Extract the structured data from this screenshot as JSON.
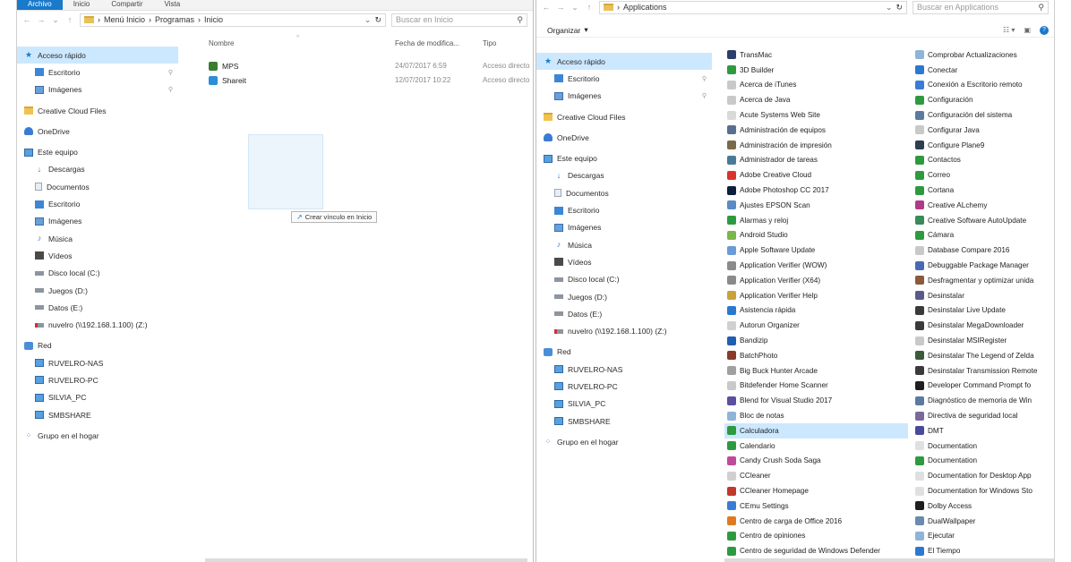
{
  "left": {
    "ribbon_tabs": [
      "Archivo",
      "Inicio",
      "Compartir",
      "Vista"
    ],
    "path": [
      "Menú Inicio",
      "Programas",
      "Inicio"
    ],
    "search_placeholder": "Buscar en Inicio",
    "nav": [
      {
        "label": "Acceso rápido",
        "icon": "star-icon",
        "sel": true
      },
      {
        "label": "Escritorio",
        "icon": "desktop-icon",
        "child": true,
        "pin": true
      },
      {
        "label": "Imágenes",
        "icon": "pictures-icon",
        "child": true,
        "pin": true
      },
      {
        "label": "Creative Cloud Files",
        "icon": "folder-icon"
      },
      {
        "label": "OneDrive",
        "icon": "cloud-icon"
      },
      {
        "label": "Este equipo",
        "icon": "computer-icon"
      },
      {
        "label": "Descargas",
        "icon": "download-icon",
        "child": true
      },
      {
        "label": "Documentos",
        "icon": "documents-icon",
        "child": true
      },
      {
        "label": "Escritorio",
        "icon": "desktop-icon",
        "child": true
      },
      {
        "label": "Imágenes",
        "icon": "pictures-icon",
        "child": true
      },
      {
        "label": "Música",
        "icon": "music-icon",
        "child": true
      },
      {
        "label": "Vídeos",
        "icon": "video-icon",
        "child": true
      },
      {
        "label": "Disco local (C:)",
        "icon": "drive-icon",
        "child": true
      },
      {
        "label": "Juegos (D:)",
        "icon": "drive-icon",
        "child": true
      },
      {
        "label": "Datos (E:)",
        "icon": "drive-icon",
        "child": true
      },
      {
        "label": "nuvelro (\\\\192.168.1.100) (Z:)",
        "icon": "network-drive-icon",
        "child": true
      },
      {
        "label": "Red",
        "icon": "network-icon"
      },
      {
        "label": "RUVELRO-NAS",
        "icon": "network-computer-icon",
        "child": true
      },
      {
        "label": "RUVELRO-PC",
        "icon": "network-computer-icon",
        "child": true
      },
      {
        "label": "SILVIA_PC",
        "icon": "network-computer-icon",
        "child": true
      },
      {
        "label": "SMBSHARE",
        "icon": "network-computer-icon",
        "child": true
      },
      {
        "label": "Grupo en el hogar",
        "icon": "homegroup-icon"
      }
    ],
    "columns": {
      "name": "Nombre",
      "date": "Fecha de modifica...",
      "type": "Tipo"
    },
    "files": [
      {
        "name": "MPS",
        "date": "24/07/2017 6:59",
        "type": "Acceso directo",
        "color": "#3b7d2e"
      },
      {
        "name": "Shareit",
        "date": "12/07/2017 10:22",
        "type": "Acceso directo",
        "color": "#2a8fd6"
      }
    ],
    "drop_tooltip": "Crear vínculo en Inicio"
  },
  "right": {
    "path": [
      "Applications"
    ],
    "search_placeholder": "Buscar en Applications",
    "organize_label": "Organizar",
    "nav": [
      {
        "label": "Acceso rápido",
        "icon": "star-icon",
        "sel": true
      },
      {
        "label": "Escritorio",
        "icon": "desktop-icon",
        "child": true,
        "pin": true
      },
      {
        "label": "Imágenes",
        "icon": "pictures-icon",
        "child": true,
        "pin": true
      },
      {
        "label": "Creative Cloud Files",
        "icon": "folder-icon"
      },
      {
        "label": "OneDrive",
        "icon": "cloud-icon"
      },
      {
        "label": "Este equipo",
        "icon": "computer-icon"
      },
      {
        "label": "Descargas",
        "icon": "download-icon",
        "child": true
      },
      {
        "label": "Documentos",
        "icon": "documents-icon",
        "child": true
      },
      {
        "label": "Escritorio",
        "icon": "desktop-icon",
        "child": true
      },
      {
        "label": "Imágenes",
        "icon": "pictures-icon",
        "child": true
      },
      {
        "label": "Música",
        "icon": "music-icon",
        "child": true
      },
      {
        "label": "Vídeos",
        "icon": "video-icon",
        "child": true
      },
      {
        "label": "Disco local (C:)",
        "icon": "drive-icon",
        "child": true
      },
      {
        "label": "Juegos (D:)",
        "icon": "drive-icon",
        "child": true
      },
      {
        "label": "Datos (E:)",
        "icon": "drive-icon",
        "child": true
      },
      {
        "label": "nuvelro (\\\\192.168.1.100) (Z:)",
        "icon": "network-drive-icon",
        "child": true
      },
      {
        "label": "Red",
        "icon": "network-icon"
      },
      {
        "label": "RUVELRO-NAS",
        "icon": "network-computer-icon",
        "child": true
      },
      {
        "label": "RUVELRO-PC",
        "icon": "network-computer-icon",
        "child": true
      },
      {
        "label": "SILVIA_PC",
        "icon": "network-computer-icon",
        "child": true
      },
      {
        "label": "SMBSHARE",
        "icon": "network-computer-icon",
        "child": true
      },
      {
        "label": "Grupo en el hogar",
        "icon": "homegroup-icon"
      }
    ],
    "apps_col1": [
      {
        "label": "TransMac",
        "color": "#2c3e6b"
      },
      {
        "label": "3D Builder",
        "color": "#2e9a3f"
      },
      {
        "label": "Acerca de iTunes",
        "color": "#c9c9c9"
      },
      {
        "label": "Acerca de Java",
        "color": "#c9c9c9"
      },
      {
        "label": "Acute Systems Web Site",
        "color": "#d9d9d9"
      },
      {
        "label": "Administración de equipos",
        "color": "#5a6f8f"
      },
      {
        "label": "Administración de impresión",
        "color": "#7a6a4a"
      },
      {
        "label": "Administrador de tareas",
        "color": "#4a7a9a"
      },
      {
        "label": "Adobe Creative Cloud",
        "color": "#d9342b"
      },
      {
        "label": "Adobe Photoshop CC 2017",
        "color": "#0d1f3c"
      },
      {
        "label": "Ajustes EPSON Scan",
        "color": "#5a8ac8"
      },
      {
        "label": "Alarmas y reloj",
        "color": "#2e9a3f"
      },
      {
        "label": "Android Studio",
        "color": "#7ab648"
      },
      {
        "label": "Apple Software Update",
        "color": "#6a9bd8"
      },
      {
        "label": "Application Verifier (WOW)",
        "color": "#8a8a8a"
      },
      {
        "label": "Application Verifier (X64)",
        "color": "#8a8a8a"
      },
      {
        "label": "Application Verifier Help",
        "color": "#c9a23a"
      },
      {
        "label": "Asistencia rápida",
        "color": "#2a78d2"
      },
      {
        "label": "Autorun Organizer",
        "color": "#d0d0d0"
      },
      {
        "label": "Bandizip",
        "color": "#1f5fb0"
      },
      {
        "label": "BatchPhoto",
        "color": "#8a3a2a"
      },
      {
        "label": "Big Buck Hunter Arcade",
        "color": "#a0a0a0"
      },
      {
        "label": "Bitdefender Home Scanner",
        "color": "#c9c9c9"
      },
      {
        "label": "Blend for Visual Studio 2017",
        "color": "#5a4fa0"
      },
      {
        "label": "Bloc de notas",
        "color": "#8fb4d8"
      },
      {
        "label": "Calculadora",
        "color": "#2e9a3f",
        "sel": true
      },
      {
        "label": "Calendario",
        "color": "#2e9a3f"
      },
      {
        "label": "Candy Crush Soda Saga",
        "color": "#c04a9a"
      },
      {
        "label": "CCleaner",
        "color": "#d0d0d0"
      },
      {
        "label": "CCleaner Homepage",
        "color": "#c0392b"
      },
      {
        "label": "CEmu Settings",
        "color": "#3a7bd5"
      },
      {
        "label": "Centro de carga de Office 2016",
        "color": "#e07a20"
      },
      {
        "label": "Centro de opiniones",
        "color": "#2e9a3f"
      },
      {
        "label": "Centro de seguridad de Windows Defender",
        "color": "#2e9a3f"
      }
    ],
    "apps_col2": [
      {
        "label": "Comprobar Actualizaciones",
        "color": "#8fb4d8"
      },
      {
        "label": "Conectar",
        "color": "#2a78d2"
      },
      {
        "label": "Conexión a Escritorio remoto",
        "color": "#3a7bd5"
      },
      {
        "label": "Configuración",
        "color": "#2e9a3f"
      },
      {
        "label": "Configuración del sistema",
        "color": "#5a7aa0"
      },
      {
        "label": "Configurar Java",
        "color": "#c9c9c9"
      },
      {
        "label": "Configure Plane9",
        "color": "#2c3e50"
      },
      {
        "label": "Contactos",
        "color": "#2e9a3f"
      },
      {
        "label": "Correo",
        "color": "#2e9a3f"
      },
      {
        "label": "Cortana",
        "color": "#2e9a3f"
      },
      {
        "label": "Creative ALchemy",
        "color": "#b03a8a"
      },
      {
        "label": "Creative Software AutoUpdate",
        "color": "#3a8a5a"
      },
      {
        "label": "Cámara",
        "color": "#2e9a3f"
      },
      {
        "label": "Database Compare 2016",
        "color": "#c9c9c9"
      },
      {
        "label": "Debuggable Package Manager",
        "color": "#4a6ab0"
      },
      {
        "label": "Desfragmentar y optimizar unida",
        "color": "#8a5a3a"
      },
      {
        "label": "Desinstalar",
        "color": "#5a5a8a"
      },
      {
        "label": "Desinstalar Live Update",
        "color": "#3a3a3a"
      },
      {
        "label": "Desinstalar MegaDownloader",
        "color": "#3a3a3a"
      },
      {
        "label": "Desinstalar MSIRegister",
        "color": "#c9c9c9"
      },
      {
        "label": "Desinstalar The Legend of Zelda",
        "color": "#3a5a3a"
      },
      {
        "label": "Desinstalar Transmission Remote",
        "color": "#3a3a3a"
      },
      {
        "label": "Developer Command Prompt fo",
        "color": "#1e1e1e"
      },
      {
        "label": "Diagnóstico de memoria de Win",
        "color": "#5a7aa0"
      },
      {
        "label": "Directiva de seguridad local",
        "color": "#7a6a9a"
      },
      {
        "label": "DMT",
        "color": "#4a4a9a"
      },
      {
        "label": "Documentation",
        "color": "#e0e0e0"
      },
      {
        "label": "Documentation",
        "color": "#2e9a3f"
      },
      {
        "label": "Documentation for Desktop App",
        "color": "#e0e0e0"
      },
      {
        "label": "Documentation for Windows Sto",
        "color": "#e0e0e0"
      },
      {
        "label": "Dolby Access",
        "color": "#1e1e1e"
      },
      {
        "label": "DualWallpaper",
        "color": "#6a8ab0"
      },
      {
        "label": "Ejecutar",
        "color": "#8fb4d8"
      },
      {
        "label": "El Tiempo",
        "color": "#2a78d2"
      }
    ]
  }
}
